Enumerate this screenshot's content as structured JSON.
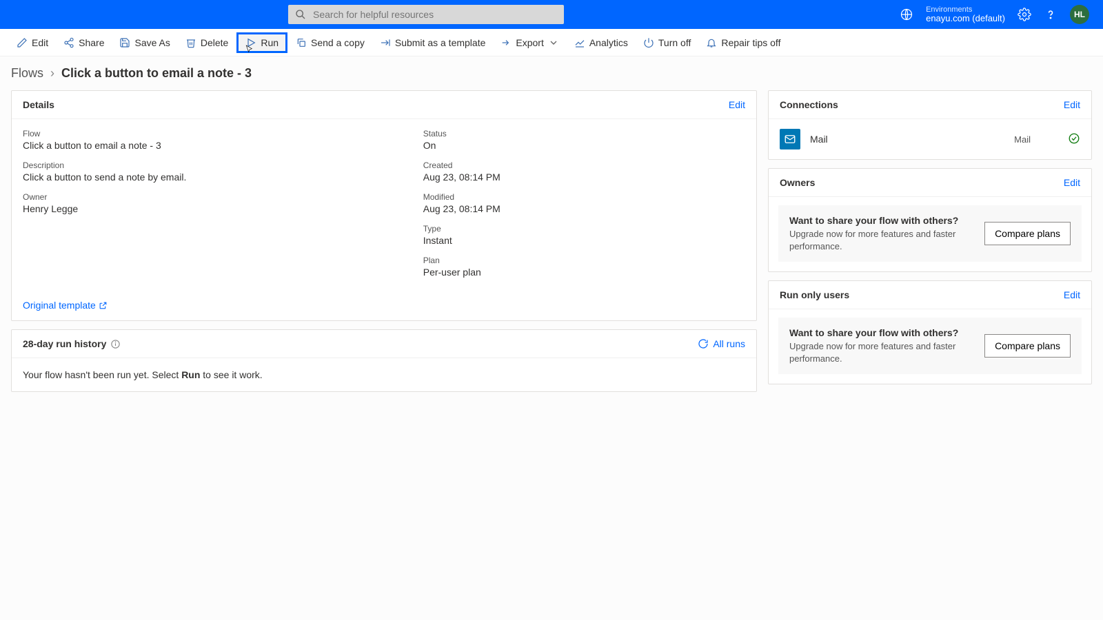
{
  "header": {
    "search_placeholder": "Search for helpful resources",
    "env_label": "Environments",
    "env_name": "enayu.com (default)",
    "avatar": "HL"
  },
  "toolbar": {
    "edit": "Edit",
    "share": "Share",
    "saveas": "Save As",
    "delete": "Delete",
    "run": "Run",
    "sendcopy": "Send a copy",
    "submit_template": "Submit as a template",
    "export": "Export",
    "analytics": "Analytics",
    "turnoff": "Turn off",
    "repair": "Repair tips off"
  },
  "breadcrumb": {
    "root": "Flows",
    "current": "Click a button to email a note - 3"
  },
  "details": {
    "title": "Details",
    "edit": "Edit",
    "flow_label": "Flow",
    "flow_value": "Click a button to email a note - 3",
    "desc_label": "Description",
    "desc_value": "Click a button to send a note by email.",
    "owner_label": "Owner",
    "owner_value": "Henry Legge",
    "status_label": "Status",
    "status_value": "On",
    "created_label": "Created",
    "created_value": "Aug 23, 08:14 PM",
    "modified_label": "Modified",
    "modified_value": "Aug 23, 08:14 PM",
    "type_label": "Type",
    "type_value": "Instant",
    "plan_label": "Plan",
    "plan_value": "Per-user plan",
    "original_template": "Original template"
  },
  "history": {
    "title": "28-day run history",
    "all_runs": "All runs",
    "empty_pre": "Your flow hasn't been run yet. Select ",
    "empty_bold": "Run",
    "empty_post": " to see it work."
  },
  "connections": {
    "title": "Connections",
    "edit": "Edit",
    "item_name": "Mail",
    "item_type": "Mail"
  },
  "owners": {
    "title": "Owners",
    "edit": "Edit",
    "share_q": "Want to share your flow with others?",
    "share_sub": "Upgrade now for more features and faster performance.",
    "compare": "Compare plans"
  },
  "runonly": {
    "title": "Run only users",
    "edit": "Edit",
    "share_q": "Want to share your flow with others?",
    "share_sub": "Upgrade now for more features and faster performance.",
    "compare": "Compare plans"
  }
}
